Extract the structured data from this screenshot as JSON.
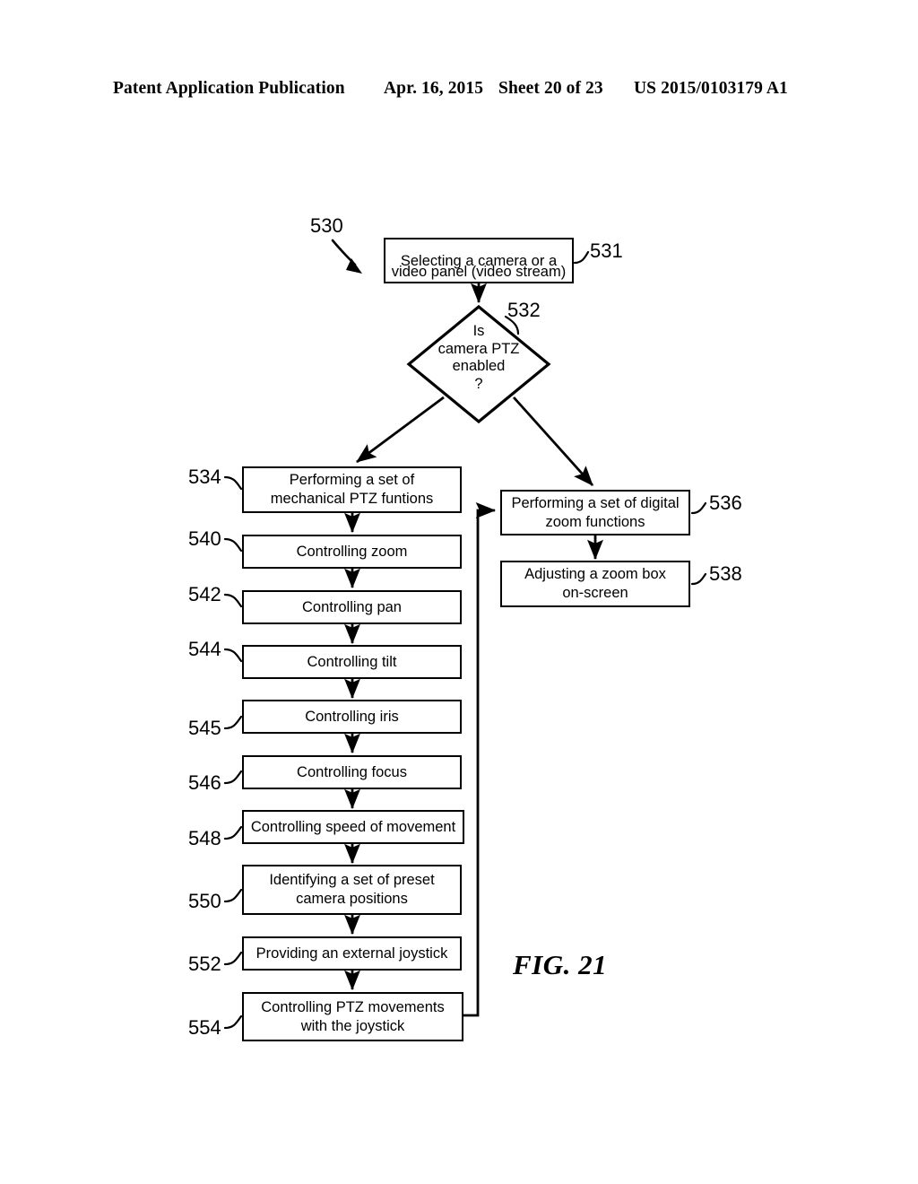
{
  "header": {
    "publication": "Patent Application Publication",
    "date": "Apr. 16, 2015",
    "sheet": "Sheet 20 of 23",
    "patent_number": "US 2015/0103179 A1"
  },
  "figure": {
    "caption": "FIG. 21",
    "diagram_ref": "530",
    "type": "flowchart",
    "nodes": [
      {
        "ref": "531",
        "shape": "process",
        "text": "Selecting a camera or a\nvideo panel (video stream)"
      },
      {
        "ref": "532",
        "shape": "decision",
        "text": "Is\ncamera PTZ\nenabled\n?"
      },
      {
        "ref": "534",
        "shape": "process",
        "text": "Performing a set of\nmechanical PTZ funtions"
      },
      {
        "ref": "536",
        "shape": "process",
        "text": "Performing a set of digital\nzoom functions"
      },
      {
        "ref": "538",
        "shape": "process",
        "text": "Adjusting a zoom box\non-screen"
      },
      {
        "ref": "540",
        "shape": "process",
        "text": "Controlling zoom"
      },
      {
        "ref": "542",
        "shape": "process",
        "text": "Controlling pan"
      },
      {
        "ref": "544",
        "shape": "process",
        "text": "Controlling tilt"
      },
      {
        "ref": "545",
        "shape": "process",
        "text": "Controlling iris"
      },
      {
        "ref": "546",
        "shape": "process",
        "text": "Controlling focus"
      },
      {
        "ref": "548",
        "shape": "process",
        "text": "Controlling speed of movement"
      },
      {
        "ref": "550",
        "shape": "process",
        "text": "Identifying a set of preset\ncamera positions"
      },
      {
        "ref": "552",
        "shape": "process",
        "text": "Providing an external joystick"
      },
      {
        "ref": "554",
        "shape": "process",
        "text": "Controlling PTZ movements\nwith the joystick"
      }
    ],
    "labels": {
      "n530": "530",
      "n531": "531",
      "n532": "532",
      "n534": "534",
      "n536": "536",
      "n538": "538",
      "n540": "540",
      "n542": "542",
      "n544": "544",
      "n545": "545",
      "n546": "546",
      "n548": "548",
      "n550": "550",
      "n552": "552",
      "n554": "554"
    },
    "text": {
      "b531_l1": "Selecting a camera or a",
      "b531_l2": "video panel (video stream)",
      "d532": "Is\ncamera PTZ\nenabled\n?",
      "b534_l1": "Performing a set of",
      "b534_l2": "mechanical PTZ funtions",
      "b536_l1": "Performing a set of digital",
      "b536_l2": "zoom functions",
      "b538_l1": "Adjusting a zoom box",
      "b538_l2": "on-screen",
      "b540": "Controlling zoom",
      "b542": "Controlling pan",
      "b544": "Controlling tilt",
      "b545": "Controlling iris",
      "b546": "Controlling focus",
      "b548": "Controlling speed of movement",
      "b550_l1": "Identifying a set of preset",
      "b550_l2": "camera positions",
      "b552": "Providing an external joystick",
      "b554_l1": "Controlling PTZ movements",
      "b554_l2": "with the joystick"
    }
  }
}
